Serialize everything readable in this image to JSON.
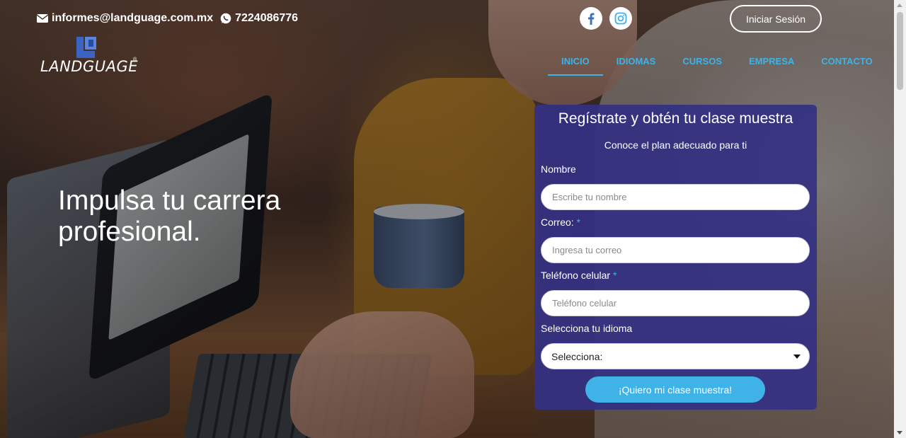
{
  "topbar": {
    "email_icon": "envelope-icon",
    "email": "informes@landguage.com.mx",
    "phone_icon": "whatsapp-icon",
    "phone": "7224086776",
    "social": [
      {
        "name": "facebook-icon",
        "color": "#3b5998"
      },
      {
        "name": "instagram-icon",
        "color": "#3fb3e8"
      }
    ],
    "login_label": "Iniciar Sesión"
  },
  "logo": {
    "text": "LANDGUAGE",
    "registered": "®"
  },
  "nav": {
    "items": [
      {
        "label": "INICIO",
        "active": true
      },
      {
        "label": "IDIOMAS",
        "active": false
      },
      {
        "label": "CURSOS",
        "active": false
      },
      {
        "label": "EMPRESA",
        "active": false
      },
      {
        "label": "CONTACTO",
        "active": false
      }
    ]
  },
  "hero": {
    "headline_line1": "Impulsa tu carrera",
    "headline_line2": "profesional."
  },
  "form": {
    "title": "Regístrate y obtén tu clase muestra",
    "subtitle": "Conoce el plan adecuado para ti",
    "name_label": "Nombre",
    "name_placeholder": "Escribe tu nombre",
    "email_label": "Correo:",
    "email_placeholder": "Ingresa tu correo",
    "phone_label": "Teléfono celular",
    "phone_placeholder": "Teléfono celular",
    "required_mark": "*",
    "language_label": "Selecciona tu idioma",
    "language_selected": "Selecciona:",
    "submit_label": "¡Quiero mi clase muestra!"
  },
  "colors": {
    "accent": "#3fb3e8",
    "card": "#34308a",
    "text_light": "#ffffff"
  }
}
